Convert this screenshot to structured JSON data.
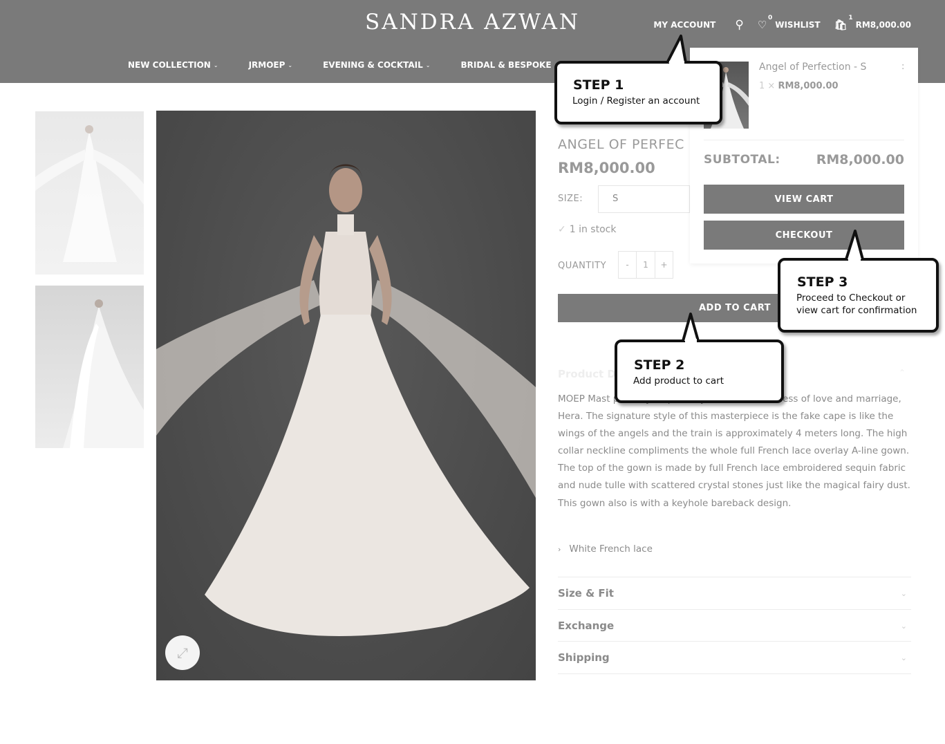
{
  "header": {
    "logo": "SANDRA AZWAN",
    "my_account": "MY ACCOUNT",
    "wishlist_count": "0",
    "wishlist_label": "WISHLIST",
    "cart_count": "1",
    "cart_total": "RM8,000.00"
  },
  "nav": {
    "items": [
      {
        "label": "NEW COLLECTION"
      },
      {
        "label": "JRMOEP"
      },
      {
        "label": "EVENING & COCKTAIL"
      },
      {
        "label": "BRIDAL & BESPOKE"
      }
    ]
  },
  "product": {
    "title": "ANGEL OF PERFEC",
    "price": "RM8,000.00",
    "size_label": "SIZE:",
    "size_value": "S",
    "stock": "1 in stock",
    "quantity_label": "QUANTITY",
    "qty_minus": "-",
    "qty_value": "1",
    "qty_plus": "+",
    "add_to_cart": "ADD TO CART",
    "description_tab": "Product D",
    "description": "MOEP Mast                                        pired by inspired by the Greek Goddess of love and marriage, Hera. The signature style of this masterpiece is the fake cape is like the wings of the angels and the train is approximately 4 meters long. The high collar neckline compliments the whole full French lace overlay A-line gown. The top of the gown is made by full French lace embroidered sequin fabric and nude tulle with scattered crystal stones just like the magical fairy dust. This gown also is with a keyhole bareback design.",
    "bullet": "White French lace",
    "accordions": [
      {
        "label": "Size & Fit"
      },
      {
        "label": "Exchange"
      },
      {
        "label": "Shipping"
      }
    ]
  },
  "minicart": {
    "item_name": "Angel of Perfection - S",
    "remove": ":",
    "item_qty": "1 ×",
    "item_price": "RM8,000.00",
    "subtotal_label": "SUBTOTAL:",
    "subtotal_value": "RM8,000.00",
    "view_cart": "VIEW CART",
    "checkout": "CHECKOUT"
  },
  "callouts": {
    "step1": {
      "title": "STEP 1",
      "text": "Login / Register an account"
    },
    "step2": {
      "title": "STEP 2",
      "text": "Add product to cart"
    },
    "step3": {
      "title": "STEP 3",
      "line1": "Proceed to Checkout or",
      "line2": "view cart for confirmation"
    }
  },
  "colors": {
    "header_bg": "#7a7a7a",
    "button_bg": "#7a7a7a",
    "callout_border": "#111111"
  }
}
